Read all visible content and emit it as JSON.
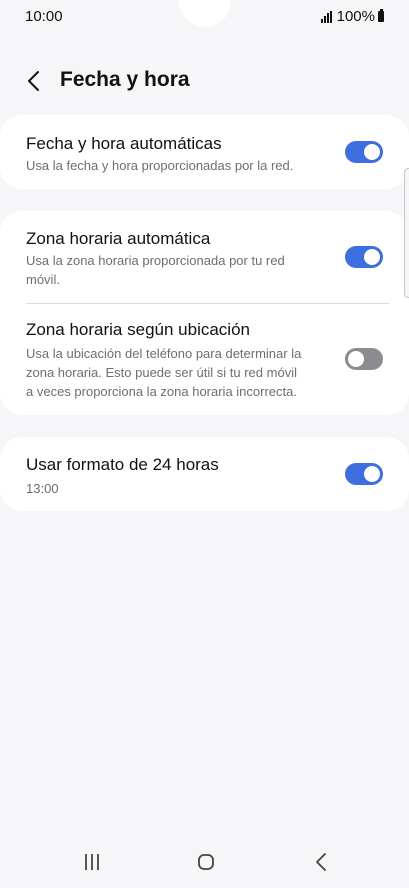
{
  "status_bar": {
    "time": "10:00",
    "battery_text": "100%",
    "icons": [
      "signal-icon",
      "battery-icon"
    ]
  },
  "header": {
    "title": "Fecha y hora",
    "back_icon": "chevron-left-icon"
  },
  "settings": {
    "auto_datetime": {
      "title": "Fecha y hora automáticas",
      "subtitle": "Usa la fecha y hora proporcionadas por la red.",
      "enabled": true
    },
    "auto_timezone": {
      "title": "Zona horaria automática",
      "subtitle_line1": "Usa la zona horaria proporcionada por tu red",
      "subtitle_line2": "móvil.",
      "enabled": true
    },
    "location_timezone": {
      "title": "Zona horaria según ubicación",
      "subtitle_line1": "Usa la ubicación del teléfono para determinar la",
      "subtitle_line2": "zona horaria. Esto puede ser útil si tu red móvil",
      "subtitle_line3": "a veces proporciona la zona horaria incorrecta.",
      "enabled": false
    },
    "format_24h": {
      "title": "Usar formato de 24 horas",
      "subtitle": "13:00",
      "enabled": true
    }
  },
  "nav_bar": {
    "icons": [
      "recent-apps-icon",
      "home-icon",
      "back-icon"
    ]
  },
  "colors": {
    "background": "#f6f6f8",
    "card": "#ffffff",
    "toggle_on": "#3e6fe1",
    "toggle_off": "#8c8c90",
    "subtitle": "#6e6e73"
  }
}
